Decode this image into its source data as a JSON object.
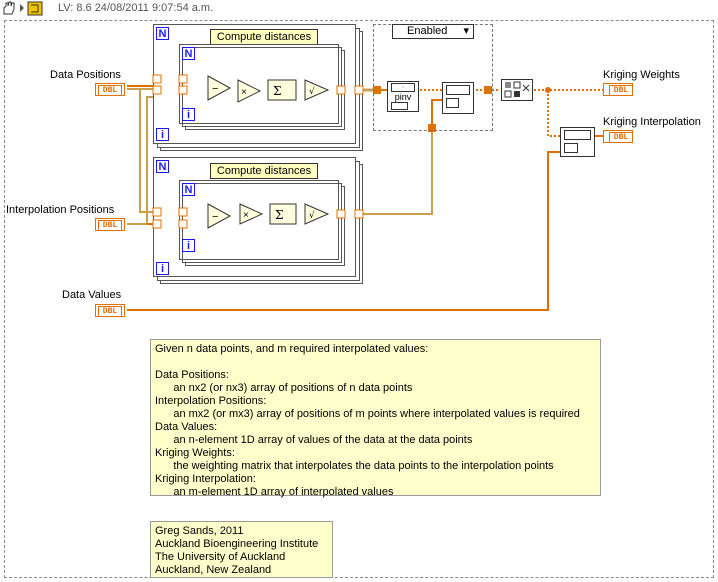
{
  "title_bar": {
    "text": "LV: 8.6 24/08/2011 9:07:54 a.m."
  },
  "inputs": {
    "data_positions": {
      "label": "Data Positions",
      "type": "DBL"
    },
    "interpolation_positions": {
      "label": "Interpolation Positions",
      "type": "DBL"
    },
    "data_values": {
      "label": "Data Values",
      "type": "DBL"
    }
  },
  "outputs": {
    "kriging_weights": {
      "label": "Kriging Weights",
      "type": "DBL"
    },
    "kriging_interpolation": {
      "label": "Kriging Interpolation",
      "type": "DBL"
    }
  },
  "loops": {
    "n": "N",
    "i": "i",
    "subvi_label": "Compute distances"
  },
  "case_structure": {
    "selector": "Enabled"
  },
  "nodes": {
    "pinv": "pinv"
  },
  "comment_main": "Given n data points, and m required interpolated values:\n\nData Positions:\n      an nx2 (or nx3) array of positions of n data points\nInterpolation Positions:\n      an mx2 (or mx3) array of positions of m points where interpolated values is required\nData Values:\n      an n-element 1D array of values of the data at the data points\nKriging Weights:\n      the weighting matrix that interpolates the data points to the interpolation points\nKriging Interpolation:\n      an m-element 1D array of interpolated values",
  "comment_credit": "Greg Sands, 2011\nAuckland Bioengineering Institute\nThe University of Auckland\nAuckland, New Zealand",
  "colors": {
    "wire_orange": "#e07000",
    "wire_tan": "#c8a050",
    "loop_index_blue": "#1a1aff",
    "comment_bg": "#ffffcc"
  }
}
